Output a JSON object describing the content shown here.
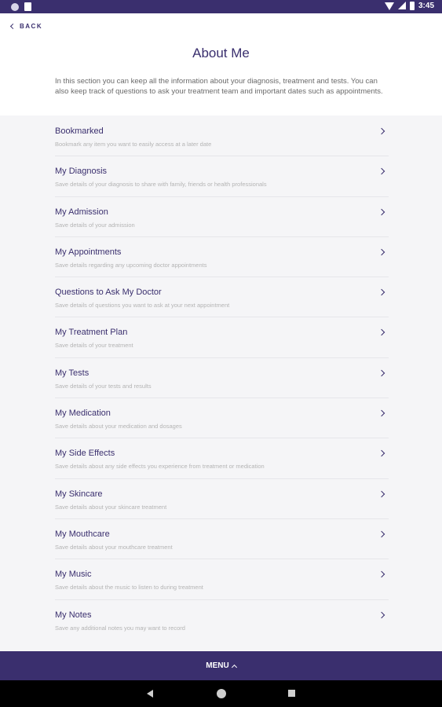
{
  "status_bar": {
    "time": "3:45"
  },
  "header": {
    "back_label": "BACK",
    "title": "About Me",
    "intro": "In this section you can keep all the information about your diagnosis, treatment and tests. You can also keep track of questions to ask your treatment team and important dates such as appointments."
  },
  "items": [
    {
      "title": "Bookmarked",
      "subtitle": "Bookmark any item you want to easily access at a later date"
    },
    {
      "title": "My Diagnosis",
      "subtitle": "Save details of your diagnosis to share with family, friends or health professionals"
    },
    {
      "title": "My Admission",
      "subtitle": "Save details of your admission"
    },
    {
      "title": "My Appointments",
      "subtitle": "Save details regarding any upcoming doctor appointments"
    },
    {
      "title": "Questions to Ask My Doctor",
      "subtitle": "Save details of questions you want to ask at your next appointment"
    },
    {
      "title": "My Treatment Plan",
      "subtitle": "Save details of your treatment"
    },
    {
      "title": "My Tests",
      "subtitle": "Save details of your tests and results"
    },
    {
      "title": "My Medication",
      "subtitle": "Save details about your medication and dosages"
    },
    {
      "title": "My Side Effects",
      "subtitle": "Save details about any side effects you experience from treatment or medication"
    },
    {
      "title": "My Skincare",
      "subtitle": "Save details about your skincare treatment"
    },
    {
      "title": "My Mouthcare",
      "subtitle": "Save details about your mouthcare treatment"
    },
    {
      "title": "My Music",
      "subtitle": "Save details about the music to listen to during treatment"
    },
    {
      "title": "My Notes",
      "subtitle": "Save any additional notes you may want to record"
    }
  ],
  "menu": {
    "label": "MENU"
  },
  "colors": {
    "brand": "#3a2f6e",
    "background": "#f5f5f7"
  },
  "icons": {
    "back": "chevron-left-icon",
    "item": "chevron-right-icon",
    "menu": "chevron-up-icon",
    "nav": [
      "back-triangle-icon",
      "home-circle-icon",
      "recents-square-icon"
    ]
  }
}
